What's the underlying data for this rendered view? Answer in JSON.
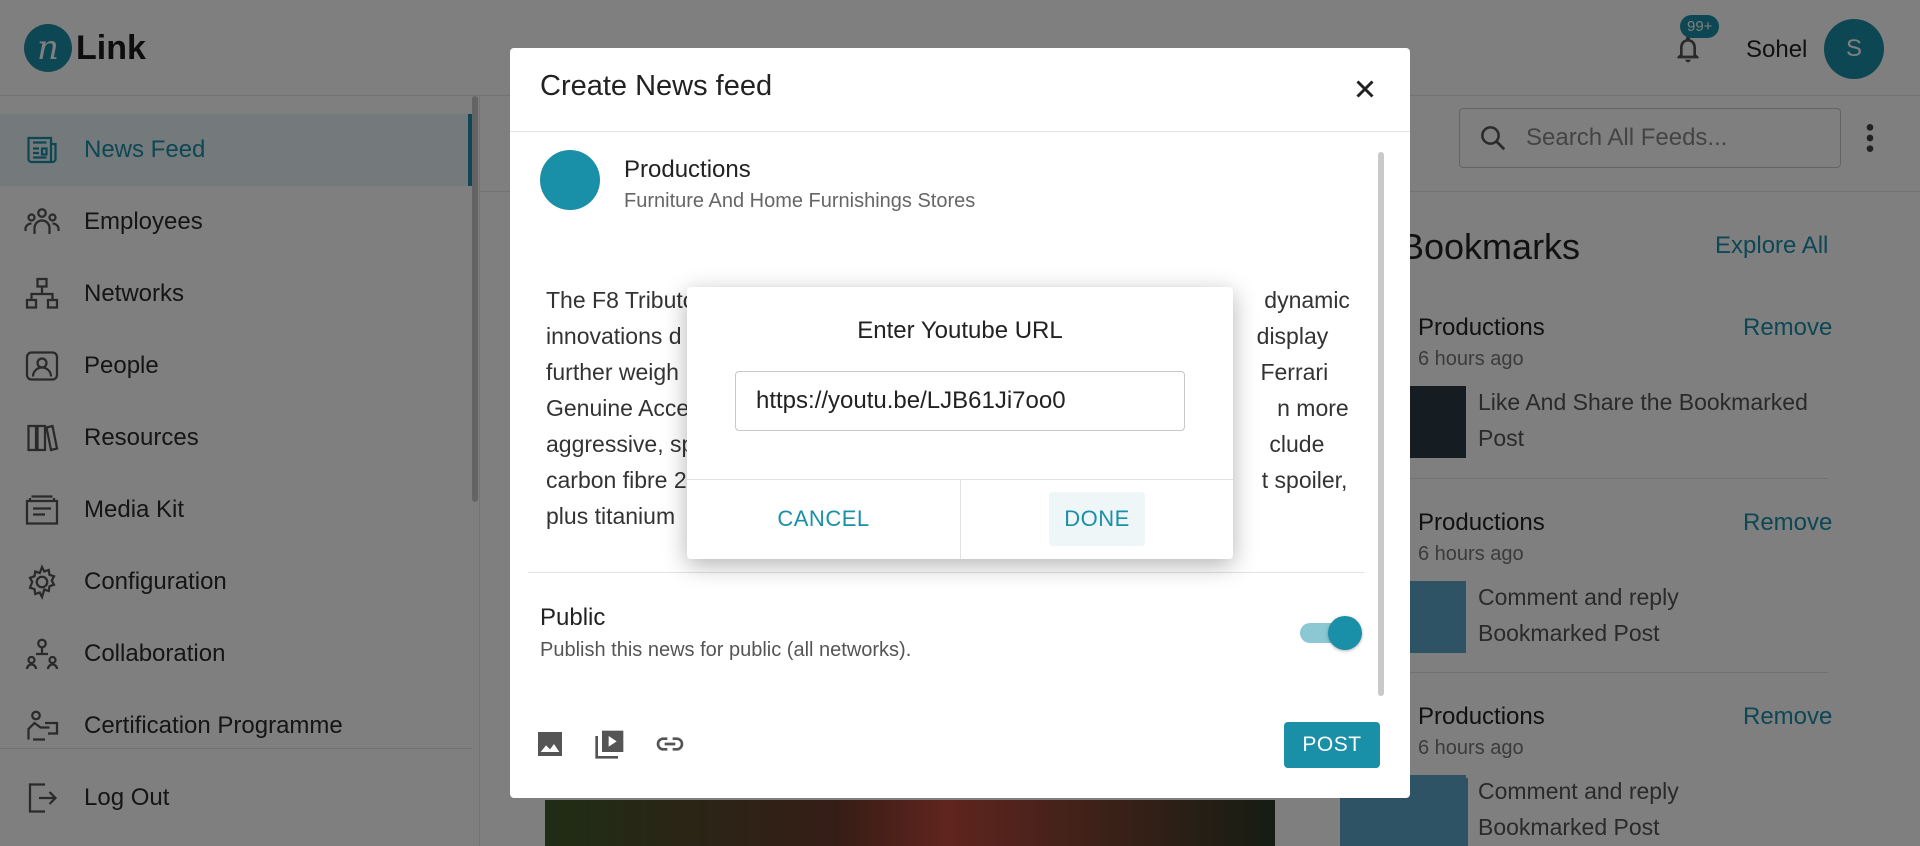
{
  "app": {
    "logo_letter": "n",
    "logo_text": "Link"
  },
  "header": {
    "notification_badge": "99+",
    "user_name": "Sohel",
    "avatar_letter": "S"
  },
  "sidebar": {
    "items": [
      {
        "label": "News Feed",
        "icon": "newspaper-icon"
      },
      {
        "label": "Employees",
        "icon": "employees-icon"
      },
      {
        "label": "Networks",
        "icon": "network-icon"
      },
      {
        "label": "People",
        "icon": "people-icon"
      },
      {
        "label": "Resources",
        "icon": "resources-icon"
      },
      {
        "label": "Media Kit",
        "icon": "media-kit-icon"
      },
      {
        "label": "Configuration",
        "icon": "gear-icon"
      },
      {
        "label": "Collaboration",
        "icon": "collaboration-icon"
      },
      {
        "label": "Certification Programme",
        "icon": "certification-icon"
      },
      {
        "label": "Log Out",
        "icon": "logout-icon"
      }
    ]
  },
  "search": {
    "placeholder": "Search All Feeds..."
  },
  "bookmarks": {
    "title": "Bookmarks",
    "explore_label": "Explore All",
    "items": [
      {
        "name": "Productions",
        "remove": "Remove",
        "time": "6 hours ago",
        "text": "Like And Share the Bookmarked Post"
      },
      {
        "name": "Productions",
        "remove": "Remove",
        "time": "6 hours ago",
        "text": "Comment and reply Bookmarked Post"
      },
      {
        "name": "Productions",
        "remove": "Remove",
        "time": "6 hours ago",
        "text": "Comment and reply Bookmarked Post"
      }
    ]
  },
  "create_dialog": {
    "title": "Create News feed",
    "org_name": "Productions",
    "org_category": "Furniture And Home Furnishings Stores",
    "body_lines": [
      "The F8 Tributo                                                                                         dynamic",
      "innovations d                                                                                          display",
      "further weigh                                                                                           Ferrari",
      "Genuine Acce                                                                                            n more",
      "aggressive, sp                                                                                          clude",
      "carbon fibre 2                                                                                          t spoiler,",
      "plus titanium"
    ],
    "public_title": "Public",
    "public_desc": "Publish this news for public (all networks).",
    "public_enabled": true,
    "post_label": "POST"
  },
  "url_modal": {
    "title": "Enter Youtube URL",
    "url_value": "https://youtu.be/LJB61Ji7oo0",
    "cancel_label": "CANCEL",
    "done_label": "DONE"
  },
  "colors": {
    "accent": "#1a8fa8"
  }
}
